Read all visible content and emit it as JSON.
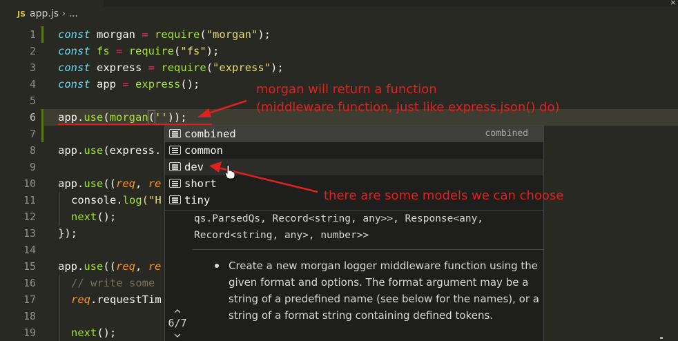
{
  "breadcrumb": {
    "file_badge": "JS",
    "file": "app.js",
    "separator": "›",
    "ellipsis": "..."
  },
  "window": {
    "close_glyph": "×"
  },
  "editor": {
    "line_numbers": [
      "1",
      "2",
      "3",
      "4",
      "5",
      "6",
      "7",
      "8",
      "9",
      "10",
      "11",
      "12",
      "13",
      "14",
      "15",
      "16",
      "17",
      "18",
      "19"
    ],
    "active_line": "6",
    "lines": {
      "l1": {
        "a": "const",
        "b": " morgan ",
        "c": "=",
        "d": " ",
        "e": "require",
        "f": "(",
        "g": "\"morgan\"",
        "h": ");"
      },
      "l2": {
        "a": "const",
        "b": " ",
        "c": "fs",
        "d": " = ",
        "e": "require",
        "f": "(",
        "g": "\"fs\"",
        "h": ");"
      },
      "l3": {
        "a": "const",
        "b": " express ",
        "c": "=",
        "d": " ",
        "e": "require",
        "f": "(",
        "g": "\"express\"",
        "h": ");"
      },
      "l4": {
        "a": "const",
        "b": " app ",
        "c": "=",
        "d": " ",
        "e": "express",
        "f": "();"
      },
      "l6": {
        "a": "app",
        "b": ".",
        "c": "use",
        "d": "(",
        "e": "morgan",
        "f": "(",
        "g": "''",
        "h": "));"
      },
      "l8": {
        "a": "app",
        "b": ".",
        "c": "use",
        "d": "(express."
      },
      "l10": {
        "a": "app",
        "b": ".",
        "c": "use",
        "d": "((",
        "e": "req",
        "f": ", ",
        "g": "re"
      },
      "l11": {
        "a": "console",
        "b": ".",
        "c": "log",
        "d": "(\"H"
      },
      "l12": {
        "a": "next",
        "b": "();"
      },
      "l13": {
        "a": "});"
      },
      "l15": {
        "a": "app",
        "b": ".",
        "c": "use",
        "d": "((",
        "e": "req",
        "f": ", ",
        "g": "re"
      },
      "l16": {
        "a": "// write some"
      },
      "l17": {
        "a": "req",
        "b": ".requestTim"
      },
      "l19": {
        "a": "next",
        "b": "();"
      }
    }
  },
  "suggestions": {
    "items": [
      {
        "label": "combined",
        "detail": "combined"
      },
      {
        "label": "common",
        "detail": ""
      },
      {
        "label": "dev",
        "detail": ""
      },
      {
        "label": "short",
        "detail": ""
      },
      {
        "label": "tiny",
        "detail": ""
      }
    ],
    "selected": "combined",
    "hovered": "dev"
  },
  "details": {
    "signature_line1": "qs.ParsedQs, Record<string, any>>, Response<any,",
    "signature_line2": "Record<string, any>, number>>",
    "doc": "Create a new morgan logger middleware function using the given format and options. The format argument may be a string of a predefined name (see below for the names), or a string of a format string containing defined tokens.",
    "pager": "6/7"
  },
  "annotations": {
    "top_line1": "morgan will return a function",
    "top_line2": "(middleware function, just like express.json() do)",
    "bottom": "there are some models we can choose",
    "color": "#e32020"
  },
  "colors": {
    "background": "#282923",
    "keyword": "#66d9ef",
    "string": "#e6db74",
    "function": "#a6e22e",
    "operator": "#f92672",
    "parameter": "#fd971f"
  }
}
